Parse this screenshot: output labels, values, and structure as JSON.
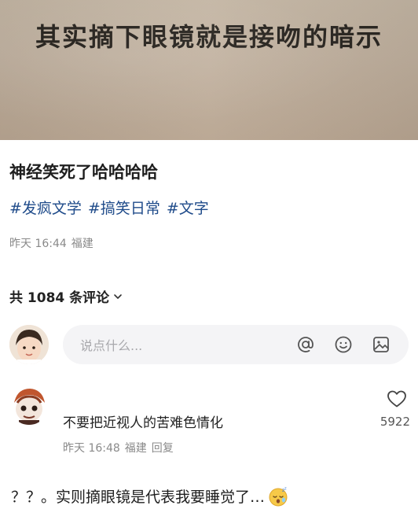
{
  "cover": {
    "overlay_text": "其实摘下眼镜就是接吻的暗示"
  },
  "post": {
    "title": "神经笑死了哈哈哈哈",
    "tags": [
      "#发疯文学",
      "#搞笑日常",
      "#文字"
    ],
    "time": "昨天 16:44",
    "location": "福建"
  },
  "comments_header": {
    "count_label": "共 1084 条评论",
    "chevron_icon": "chevron-down-icon"
  },
  "composer": {
    "placeholder": "说点什么...",
    "icons": [
      "at-icon",
      "emoji-icon",
      "image-icon"
    ]
  },
  "comments": [
    {
      "text": "不要把近视人的苦难色情化",
      "time": "昨天 16:48",
      "location": "福建",
      "reply_label": "回复",
      "likes": "5922"
    }
  ],
  "next_comment": {
    "text": "？？。实则摘眼镜是代表我要睡觉了…",
    "emoji_icon": "sleeping-face-icon"
  },
  "colors": {
    "tag_blue": "#1f4b8a",
    "meta_gray": "#8a8a8a",
    "input_bg": "#f4f4f6"
  }
}
